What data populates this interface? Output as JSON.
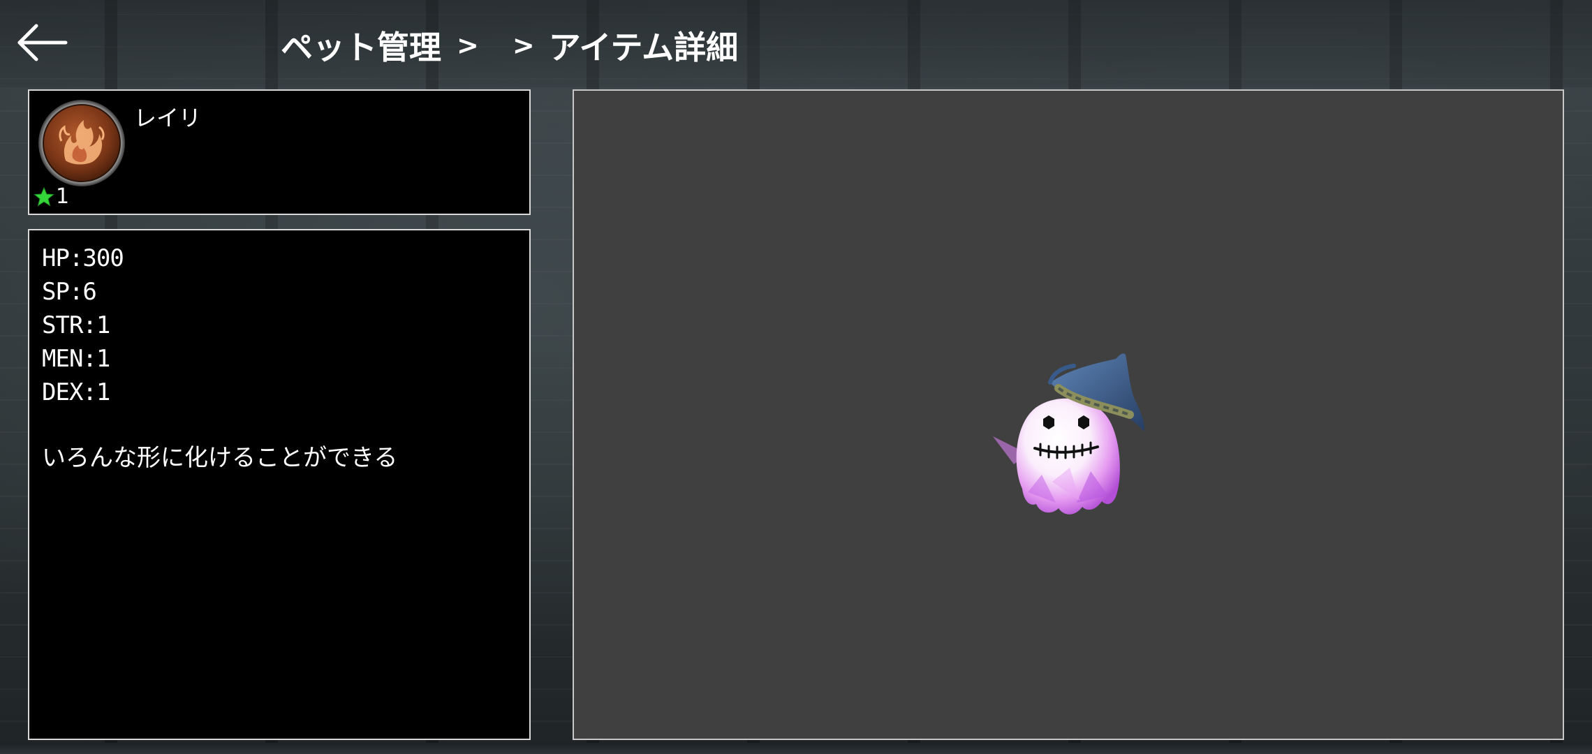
{
  "header": {
    "back_icon": "arrow-left-icon",
    "breadcrumb": {
      "first": "ペット管理",
      "separator1": ">",
      "separator2": ">",
      "current": "アイテム詳細"
    }
  },
  "pet": {
    "name": "レイリ",
    "icon": "fox-emblem-icon",
    "rank_icon": "green-star-icon",
    "rank": "1"
  },
  "stats": {
    "hp": "HP:300",
    "sp": "SP:6",
    "str": "STR:1",
    "men": "MEN:1",
    "dex": "DEX:1"
  },
  "description": "いろんな形に化けることができる",
  "preview": {
    "model_icon": "ghost-with-witch-hat",
    "background_color": "#404040"
  },
  "colors": {
    "panel_border": "#d9d9d9",
    "panel_background": "#000000",
    "rank_star": "#35d63a"
  }
}
